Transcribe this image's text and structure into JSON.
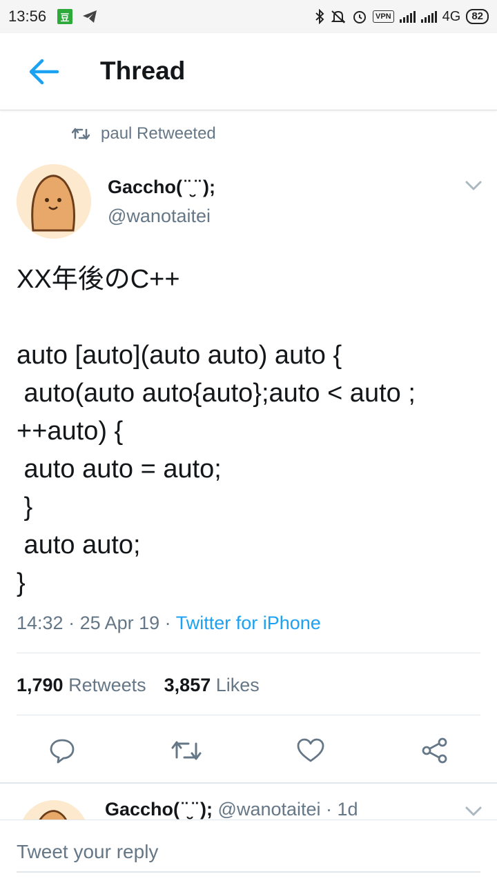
{
  "status_bar": {
    "time": "13:56",
    "app_badge": "豆",
    "network": "4G",
    "vpn": "VPN",
    "battery": "82"
  },
  "header": {
    "title": "Thread"
  },
  "retweet_banner": {
    "text": "paul Retweeted"
  },
  "tweet": {
    "author_name": "Gaccho( ̈ ̮ ̈ );",
    "author_handle": "@wanotaitei",
    "body": "XX年後のC++\n\nauto [auto](auto auto) auto {\n auto(auto auto{auto};auto < auto ;\n++auto) {\n auto auto = auto;\n }\n auto auto;\n}",
    "time": "14:32",
    "date": "25 Apr 19",
    "source": "Twitter for iPhone",
    "retweets_count": "1,790",
    "retweets_label": "Retweets",
    "likes_count": "3,857",
    "likes_label": "Likes"
  },
  "reply_preview": {
    "author_name": "Gaccho( ̈ ̮ ̈ );",
    "author_handle": "@wanotaitei",
    "age": "1d"
  },
  "composer": {
    "placeholder": "Tweet your reply"
  },
  "colors": {
    "accent": "#1da1f2",
    "secondary_text": "#657786",
    "divider": "#e1e8ed"
  }
}
